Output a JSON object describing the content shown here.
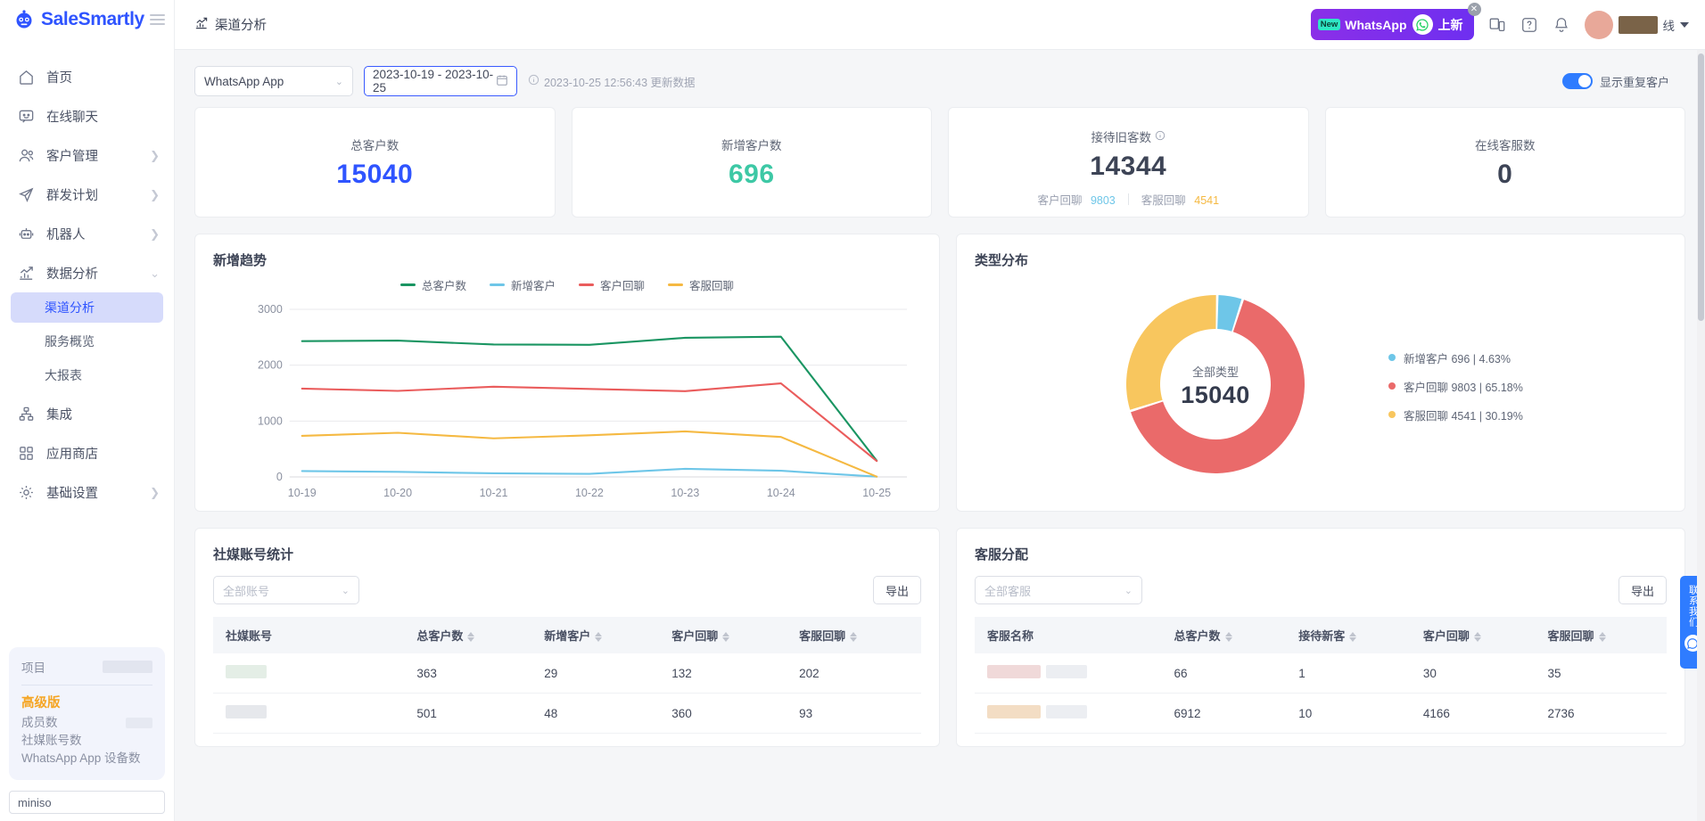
{
  "brand": {
    "name": "SaleSmartly",
    "logo_icon": "robot-logo-icon",
    "menu_icon": "hamburger-icon"
  },
  "sidebar": {
    "items": [
      {
        "label": "首页",
        "icon": "home-icon",
        "expandable": false
      },
      {
        "label": "在线聊天",
        "icon": "chat-icon",
        "expandable": false
      },
      {
        "label": "客户管理",
        "icon": "users-icon",
        "expandable": true
      },
      {
        "label": "群发计划",
        "icon": "send-icon",
        "expandable": true
      },
      {
        "label": "机器人",
        "icon": "robot-icon",
        "expandable": true
      },
      {
        "label": "数据分析",
        "icon": "analytics-icon",
        "expandable": true,
        "expanded": true
      },
      {
        "label": "集成",
        "icon": "integration-icon",
        "expandable": false
      },
      {
        "label": "应用商店",
        "icon": "apps-icon",
        "expandable": false
      },
      {
        "label": "基础设置",
        "icon": "gear-icon",
        "expandable": true
      }
    ],
    "subitems": [
      {
        "label": "渠道分析",
        "active": true
      },
      {
        "label": "服务概览",
        "active": false
      },
      {
        "label": "大报表",
        "active": false
      }
    ],
    "plan": {
      "project_label": "项目",
      "badge": "高级版",
      "rows": [
        "成员数",
        "社媒账号数"
      ],
      "whatsapp_row": "WhatsApp App 设备数"
    },
    "project_input": {
      "value": "miniso",
      "placeholder": "miniso"
    }
  },
  "topbar": {
    "title": "渠道分析",
    "title_icon": "analytics-icon",
    "promo": {
      "new_badge": "New",
      "text": "WhatsApp",
      "suffix": "上新",
      "whatsapp_icon": "whatsapp-icon",
      "close_icon": "close-icon",
      "color": "#7b2ff0"
    },
    "icons": [
      "devices-icon",
      "help-icon",
      "notification-icon"
    ],
    "status_text": "线",
    "caret_icon": "chevron-down-icon"
  },
  "filters": {
    "channel_select": {
      "value": "WhatsApp App",
      "arrow_icon": "chevron-down-icon"
    },
    "date_range": {
      "value": "2023-10-19 - 2023-10-25",
      "icon": "calendar-icon"
    },
    "update_note": "2023-10-25 12:56:43 更新数据",
    "info_icon": "info-icon",
    "toggle": {
      "label": "显示重复客户",
      "on": true,
      "color": "#2f7cff"
    }
  },
  "stats": [
    {
      "label": "总客户数",
      "value": "15040",
      "color": "#2f54ff",
      "info": false
    },
    {
      "label": "新增客户数",
      "value": "696",
      "color": "#3dc8a5",
      "info": false
    },
    {
      "label": "接待旧客数",
      "value": "14344",
      "color": "#3d4456",
      "info": true,
      "sub": [
        {
          "label": "客户回聊",
          "value": "9803",
          "color": "#6ec6e8"
        },
        {
          "label": "客服回聊",
          "value": "4541",
          "color": "#f5b942"
        }
      ]
    },
    {
      "label": "在线客服数",
      "value": "0",
      "color": "#3d4456",
      "info": false
    }
  ],
  "trend_panel": {
    "title": "新增趋势"
  },
  "type_panel": {
    "title": "类型分布"
  },
  "chart_data": [
    {
      "type": "line",
      "title": "新增趋势",
      "x": [
        "10-19",
        "10-20",
        "10-21",
        "10-22",
        "10-23",
        "10-24",
        "10-25"
      ],
      "xlabel": "",
      "ylabel": "",
      "ylim": [
        0,
        3000
      ],
      "yticks": [
        0,
        1000,
        2000,
        3000
      ],
      "grid": true,
      "legend_position": "top",
      "series": [
        {
          "name": "总客户数",
          "color": "#1a9562",
          "values": [
            2430,
            2440,
            2370,
            2365,
            2490,
            2510,
            290
          ]
        },
        {
          "name": "新增客户",
          "color": "#6ec6e8",
          "values": [
            105,
            90,
            65,
            55,
            145,
            110,
            5
          ]
        },
        {
          "name": "客户回聊",
          "color": "#ea5c5c",
          "values": [
            1580,
            1540,
            1615,
            1575,
            1535,
            1675,
            285
          ]
        },
        {
          "name": "客服回聊",
          "color": "#f5b942",
          "values": [
            735,
            790,
            690,
            745,
            815,
            715,
            5
          ]
        }
      ]
    },
    {
      "type": "pie",
      "title": "类型分布",
      "center_label": "全部类型",
      "center_value": "15040",
      "legend_position": "right",
      "slices": [
        {
          "name": "新增客户",
          "value": 696,
          "percent": "4.63%",
          "color": "#6ec6e8",
          "legend": "新增客户 696 | 4.63%"
        },
        {
          "name": "客户回聊",
          "value": 9803,
          "percent": "65.18%",
          "color": "#ea6a6a",
          "legend": "客户回聊 9803 | 65.18%"
        },
        {
          "name": "客服回聊",
          "value": 4541,
          "percent": "30.19%",
          "color": "#f8c65e",
          "legend": "客服回聊 4541 | 30.19%"
        }
      ]
    }
  ],
  "social_table": {
    "title": "社媒账号统计",
    "select": {
      "placeholder": "全部账号",
      "arrow_icon": "chevron-down-icon"
    },
    "export_label": "导出",
    "columns": [
      "社媒账号",
      "总客户数",
      "新增客户",
      "客户回聊",
      "客服回聊"
    ],
    "rows": [
      {
        "account": "",
        "total": "363",
        "new": "29",
        "cust": "132",
        "agent": "202"
      },
      {
        "account": "",
        "total": "501",
        "new": "48",
        "cust": "360",
        "agent": "93"
      }
    ]
  },
  "agent_table": {
    "title": "客服分配",
    "select": {
      "placeholder": "全部客服",
      "arrow_icon": "chevron-down-icon"
    },
    "export_label": "导出",
    "columns": [
      "客服名称",
      "总客户数",
      "接待新客",
      "客户回聊",
      "客服回聊"
    ],
    "rows": [
      {
        "name": "",
        "total": "66",
        "new": "1",
        "cust": "30",
        "agent": "35"
      },
      {
        "name": "",
        "total": "6912",
        "new": "10",
        "cust": "4166",
        "agent": "2736"
      }
    ]
  },
  "fab": {
    "label": "联系我们",
    "icon": "whatsapp-icon",
    "color": "#2f7cff"
  }
}
